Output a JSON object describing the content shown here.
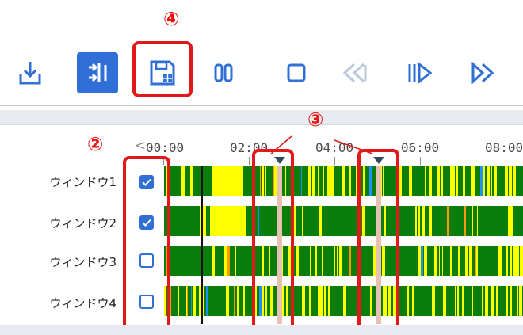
{
  "callouts": {
    "c4": "④",
    "c3": "③",
    "c2": "②"
  },
  "toolbar": {
    "buttons": [
      {
        "name": "download-button",
        "icon": "download-icon"
      },
      {
        "name": "mark-range-button",
        "icon": "mark-range-icon",
        "active": true
      },
      {
        "name": "save-button",
        "icon": "save-icon"
      },
      {
        "name": "pause-button",
        "icon": "pause-icon"
      },
      {
        "name": "stop-button",
        "icon": "stop-icon"
      },
      {
        "name": "rewind-button",
        "icon": "rewind-icon"
      },
      {
        "name": "step-play-button",
        "icon": "step-play-icon"
      },
      {
        "name": "fast-forward-button",
        "icon": "fast-forward-icon"
      }
    ],
    "accent": "#2f6fd6"
  },
  "timeline": {
    "prev_arrow": "<",
    "ticks": [
      "00:00",
      "02:00",
      "04:00",
      "06:00",
      "08:00"
    ]
  },
  "rows": [
    {
      "label": "ウィンドウ1",
      "checked": true
    },
    {
      "label": "ウィンドウ2",
      "checked": true
    },
    {
      "label": "ウィンドウ3",
      "checked": false
    },
    {
      "label": "ウィンドウ4",
      "checked": false
    }
  ],
  "colors": {
    "green": "#0a7d0a",
    "yellow": "#ffff00",
    "orange": "#ff9900",
    "blue": "#1e90ff",
    "red": "#e11919"
  }
}
